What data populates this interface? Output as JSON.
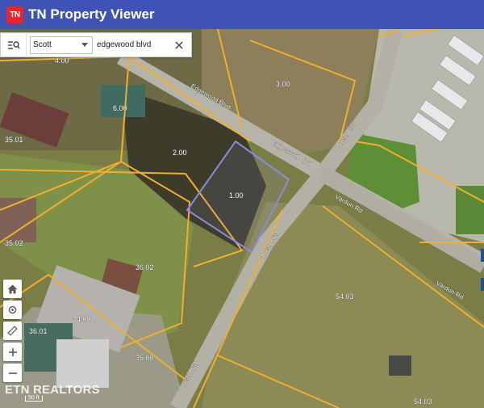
{
  "app": {
    "logo_text": "TN",
    "title": "TN Property Viewer",
    "colors": {
      "header": "#3f53b6",
      "logo": "#e7262b",
      "parcel_lines": "#f2ae2e",
      "selected_parcel": "#8a8cd8"
    }
  },
  "search": {
    "county": "Scott",
    "query": "edgewood blvd"
  },
  "tools": [
    "home-icon",
    "locate-icon",
    "measure-icon",
    "zoom-in-icon",
    "zoom-out-icon"
  ],
  "map": {
    "parcel_labels": [
      "4.00",
      "3.00",
      "6.00",
      "35.01",
      "2.00",
      "1.00",
      "35.02",
      "36.02",
      "54.03",
      "34.00",
      "36.01",
      "35.00",
      "54.03"
    ],
    "road_labels": [
      "Edgewood Blvd",
      "Edgewood Blvd",
      "Oneal Blvd",
      "Oneal Blvd",
      "Vardun Rd",
      "Vardun Rd",
      "Oneal Blvd"
    ],
    "scale_text": "50 ft",
    "watermark": "ETN REALTORS"
  }
}
